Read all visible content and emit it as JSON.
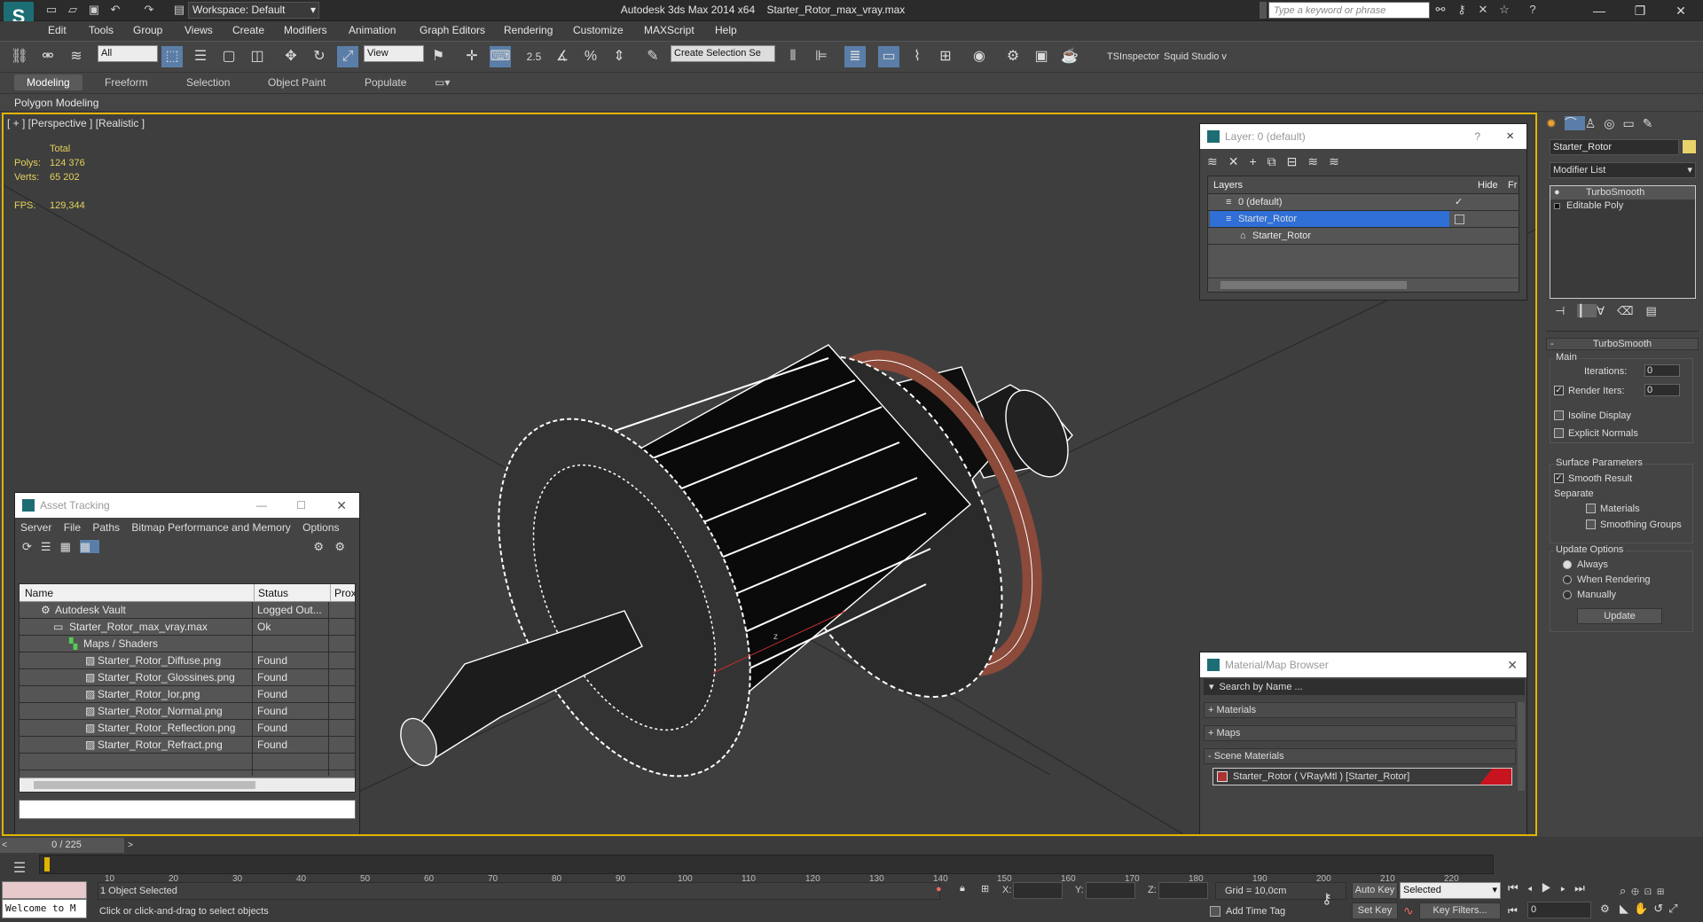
{
  "app": {
    "title": "Autodesk 3ds Max  2014 x64",
    "file": "Starter_Rotor_max_vray.max",
    "workspace": "Workspace: Default",
    "search_placeholder": "Type a keyword or phrase",
    "logo_glyph": "S"
  },
  "menu": [
    "Edit",
    "Tools",
    "Group",
    "Views",
    "Create",
    "Modifiers",
    "Animation",
    "Graph Editors",
    "Rendering",
    "Customize",
    "MAXScript",
    "Help"
  ],
  "toolbar": {
    "filter": "All",
    "ref_coord": "View",
    "snap_value": "2.5",
    "selection_set": "Create Selection Se",
    "plugins": [
      "TSInspector",
      "Squid Studio v"
    ]
  },
  "ribbon": {
    "tabs": [
      "Modeling",
      "Freeform",
      "Selection",
      "Object Paint",
      "Populate"
    ],
    "active": "Modeling",
    "panel": "Polygon Modeling"
  },
  "viewport": {
    "label": "[ + ] [Perspective ] [Realistic ]",
    "stats": {
      "total_label": "Total",
      "polys_label": "Polys:",
      "polys": "124 376",
      "verts_label": "Verts:",
      "verts": "65 202",
      "fps_label": "FPS:",
      "fps": "129,344"
    },
    "axis_label": "z",
    "wire_color": "#ffffff",
    "rim_color": "#8b4a3a"
  },
  "layer_dialog": {
    "title": "Layer: 0 (default)",
    "help": "?",
    "close": "×",
    "columns": [
      "Layers",
      "Hide",
      "Fr"
    ],
    "rows": [
      {
        "name": "0 (default)",
        "check": "✓"
      },
      {
        "name": "Starter_Rotor",
        "selected": true
      },
      {
        "name": "Starter_Rotor"
      }
    ]
  },
  "asset_tracking": {
    "title": "Asset Tracking",
    "menu": [
      "Server",
      "File",
      "Paths",
      "Bitmap Performance and Memory",
      "Options"
    ],
    "columns": [
      "Name",
      "Status",
      "Prox"
    ],
    "rows": [
      {
        "name": "Autodesk Vault",
        "status": "Logged Out..."
      },
      {
        "name": "Starter_Rotor_max_vray.max",
        "status": "Ok"
      },
      {
        "name": "Maps / Shaders",
        "status": ""
      },
      {
        "name": "Starter_Rotor_Diffuse.png",
        "status": "Found"
      },
      {
        "name": "Starter_Rotor_Glossines.png",
        "status": "Found"
      },
      {
        "name": "Starter_Rotor_Ior.png",
        "status": "Found"
      },
      {
        "name": "Starter_Rotor_Normal.png",
        "status": "Found"
      },
      {
        "name": "Starter_Rotor_Reflection.png",
        "status": "Found"
      },
      {
        "name": "Starter_Rotor_Refract.png",
        "status": "Found"
      }
    ]
  },
  "material_browser": {
    "title": "Material/Map Browser",
    "search_placeholder": "Search by Name ...",
    "sections": [
      "+ Materials",
      "+ Maps",
      "- Scene Materials"
    ],
    "scene_material": "Starter_Rotor  ( VRayMtl )  [Starter_Rotor]",
    "swatch_color": "#c8141e"
  },
  "command_panel": {
    "object_name": "Starter_Rotor",
    "modifier_list": "Modifier List",
    "stack": [
      "TurboSmooth",
      "Editable Poly"
    ],
    "rollout_title": "TurboSmooth",
    "main_label": "Main",
    "iterations_label": "Iterations:",
    "iterations": "0",
    "render_iters_label": "Render Iters:",
    "render_iters": "0",
    "isoline": "Isoline Display",
    "explicit_normals": "Explicit Normals",
    "surface_params": "Surface Parameters",
    "smooth_result": "Smooth Result",
    "separate": "Separate",
    "materials": "Materials",
    "smoothing_groups": "Smoothing Groups",
    "update_options": "Update Options",
    "always": "Always",
    "when_rendering": "When Rendering",
    "manually": "Manually",
    "update_btn": "Update"
  },
  "timeline": {
    "frame_counter": "0 / 225",
    "ticks": [
      "10",
      "20",
      "30",
      "40",
      "50",
      "60",
      "70",
      "80",
      "90",
      "100",
      "110",
      "120",
      "130",
      "140",
      "150",
      "160",
      "170",
      "180",
      "190",
      "200",
      "210",
      "220"
    ],
    "status": "1 Object Selected",
    "prompt": "Click or click-and-drag to select objects",
    "maxscript": "Welcome to M",
    "x_label": "X:",
    "y_label": "Y:",
    "z_label": "Z:",
    "grid": "Grid = 10,0cm",
    "add_time_tag": "Add Time Tag",
    "auto_key": "Auto Key",
    "set_key": "Set Key",
    "selected": "Selected",
    "key_filters": "Key Filters...",
    "frame": "0"
  }
}
